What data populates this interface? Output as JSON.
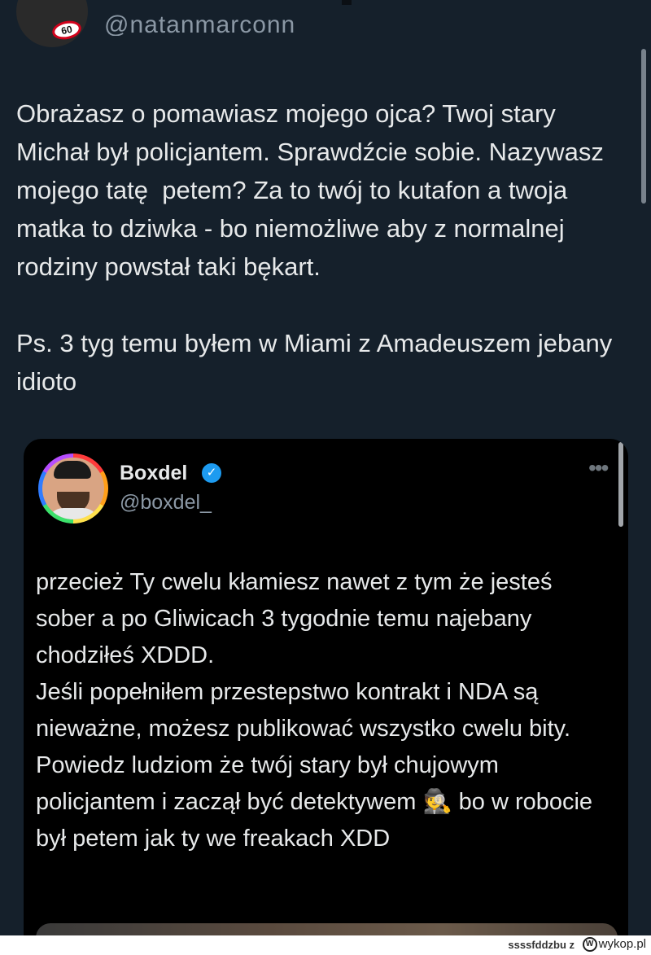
{
  "tweet": {
    "author_handle": "@natanmarconn",
    "text": "Obrażasz o pomawiasz mojego ojca? Twoj stary Michał był policjantem. Sprawdźcie sobie. Nazywasz mojego tatę  petem? Za to twój to kutafon a twoja matka to dziwka - bo niemożliwe aby z normalnej rodziny powstał taki bękart.\n\nPs. 3 tyg temu byłem w Miami z Amadeuszem jebany idioto"
  },
  "quoted_tweet": {
    "display_name": "Boxdel",
    "handle": "@boxdel_",
    "more_label": "•••",
    "verified_glyph": "✓",
    "text": "przecież Ty cwelu kłamiesz nawet z tym że jesteś sober a po Gliwicach 3 tygodnie temu najebany chodziłeś XDDD.\nJeśli popełniłem przestepstwo kontrakt i NDA są nieważne, możesz publikować wszystko cwelu bity.\nPowiedz ludziom że twój stary był chujowym policjantem i zaczął być detektywem 🕵️ bo w robocie był petem jak ty we freakach XDD"
  },
  "watermark": {
    "user": "ssssfddzbu z",
    "site": "wykop.pl",
    "site_mark": "W"
  },
  "avatar_top_sign": "60",
  "icons": [
    "verified-badge-icon",
    "more-options-icon",
    "detective-emoji-icon"
  ],
  "colors": {
    "background": "#15202b",
    "quote_background": "#000000",
    "text": "#e7e9ea",
    "muted": "#8b98a5",
    "verified": "#1d9bf0"
  }
}
